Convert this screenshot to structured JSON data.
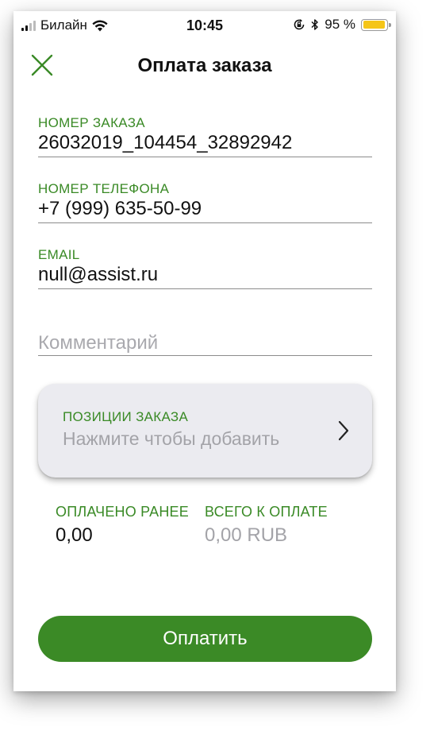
{
  "status_bar": {
    "carrier": "Билайн",
    "time": "10:45",
    "battery": "95 %",
    "battery_level": 0.95
  },
  "header": {
    "title": "Оплата заказа"
  },
  "fields": {
    "order_number": {
      "label": "НОМЕР ЗАКАЗА",
      "value": "26032019_104454_32892942"
    },
    "phone": {
      "label": "НОМЕР ТЕЛЕФОНА",
      "value": "+7 (999) 635-50-99"
    },
    "email": {
      "label": "EMAIL",
      "value": "null@assist.ru"
    },
    "comment": {
      "placeholder": "Комментарий"
    }
  },
  "order_items": {
    "label": "ПОЗИЦИИ ЗАКАЗА",
    "hint": "Нажмите чтобы добавить"
  },
  "totals": {
    "paid_label": "ОПЛАЧЕНО РАНЕЕ",
    "paid_value": "0,00",
    "total_label": "ВСЕГО К ОПЛАТЕ",
    "total_value": "0,00 RUB"
  },
  "pay_button": {
    "label": "Оплатить"
  },
  "colors": {
    "accent": "#3a8a26",
    "placeholder": "#a9a9ae",
    "card": "#ebebf0"
  }
}
